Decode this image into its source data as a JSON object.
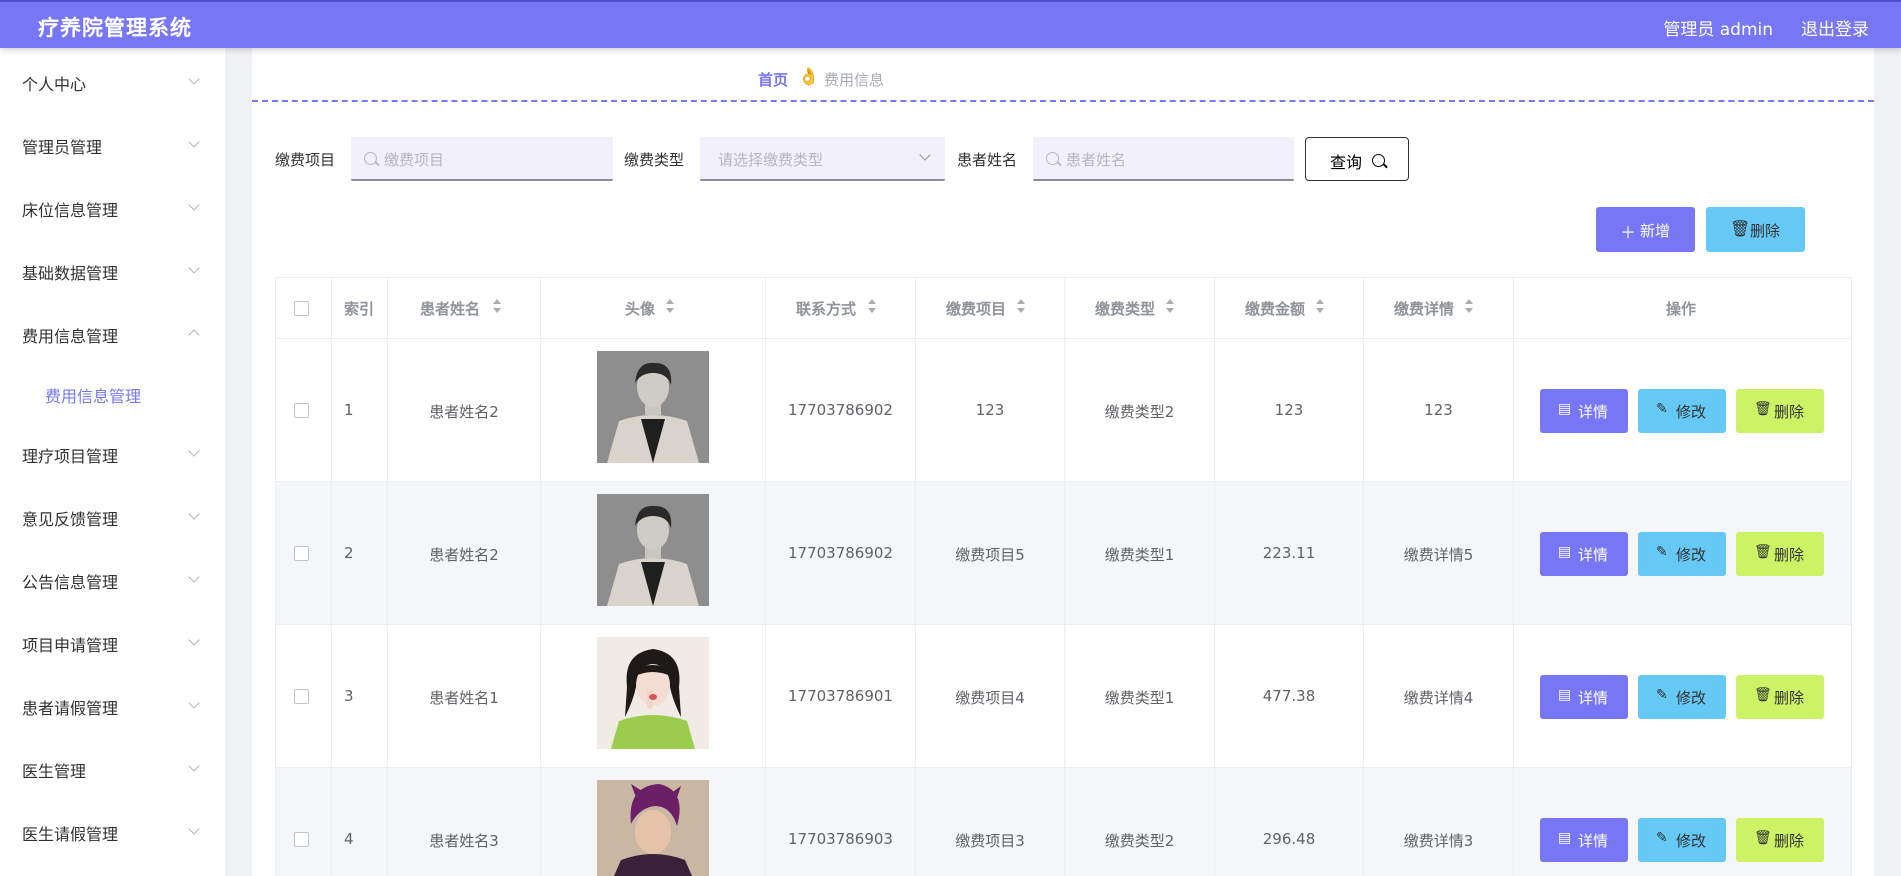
{
  "header": {
    "title": "疗养院管理系统",
    "user_label": "管理员 admin",
    "logout_label": "退出登录"
  },
  "sidebar": {
    "items": [
      {
        "label": "个人中心",
        "expanded": false
      },
      {
        "label": "管理员管理",
        "expanded": false
      },
      {
        "label": "床位信息管理",
        "expanded": false
      },
      {
        "label": "基础数据管理",
        "expanded": false
      },
      {
        "label": "费用信息管理",
        "expanded": true
      },
      {
        "label": "理疗项目管理",
        "expanded": false
      },
      {
        "label": "意见反馈管理",
        "expanded": false
      },
      {
        "label": "公告信息管理",
        "expanded": false
      },
      {
        "label": "项目申请管理",
        "expanded": false
      },
      {
        "label": "患者请假管理",
        "expanded": false
      },
      {
        "label": "医生管理",
        "expanded": false
      },
      {
        "label": "医生请假管理",
        "expanded": false
      }
    ],
    "active_sub": "费用信息管理"
  },
  "breadcrumb": {
    "home": "首页",
    "current": "费用信息",
    "separator_icon": "hand-icon"
  },
  "filters": {
    "item_label": "缴费项目",
    "item_placeholder": "缴费项目",
    "type_label": "缴费类型",
    "type_placeholder": "请选择缴费类型",
    "name_label": "患者姓名",
    "name_placeholder": "患者姓名",
    "query_label": "查询"
  },
  "actions": {
    "add_label": "新增",
    "delete_label": "删除"
  },
  "table": {
    "columns": [
      "索引",
      "患者姓名",
      "头像",
      "联系方式",
      "缴费项目",
      "缴费类型",
      "缴费金额",
      "缴费详情",
      "操作"
    ],
    "buttons": {
      "detail": "详情",
      "edit": "修改",
      "remove": "删除"
    },
    "rows": [
      {
        "index": "1",
        "name": "患者姓名2",
        "phone": "17703786902",
        "item": "123",
        "type": "缴费类型2",
        "amount": "123",
        "detail": "123"
      },
      {
        "index": "2",
        "name": "患者姓名2",
        "phone": "17703786902",
        "item": "缴费项目5",
        "type": "缴费类型1",
        "amount": "223.11",
        "detail": "缴费详情5"
      },
      {
        "index": "3",
        "name": "患者姓名1",
        "phone": "17703786901",
        "item": "缴费项目4",
        "type": "缴费类型1",
        "amount": "477.38",
        "detail": "缴费详情4"
      },
      {
        "index": "4",
        "name": "患者姓名3",
        "phone": "17703786903",
        "item": "缴费项目3",
        "type": "缴费类型2",
        "amount": "296.48",
        "detail": "缴费详情3"
      }
    ]
  },
  "colors": {
    "primary": "#7777f5",
    "info": "#66c9f5",
    "warn": "#ccf266"
  }
}
